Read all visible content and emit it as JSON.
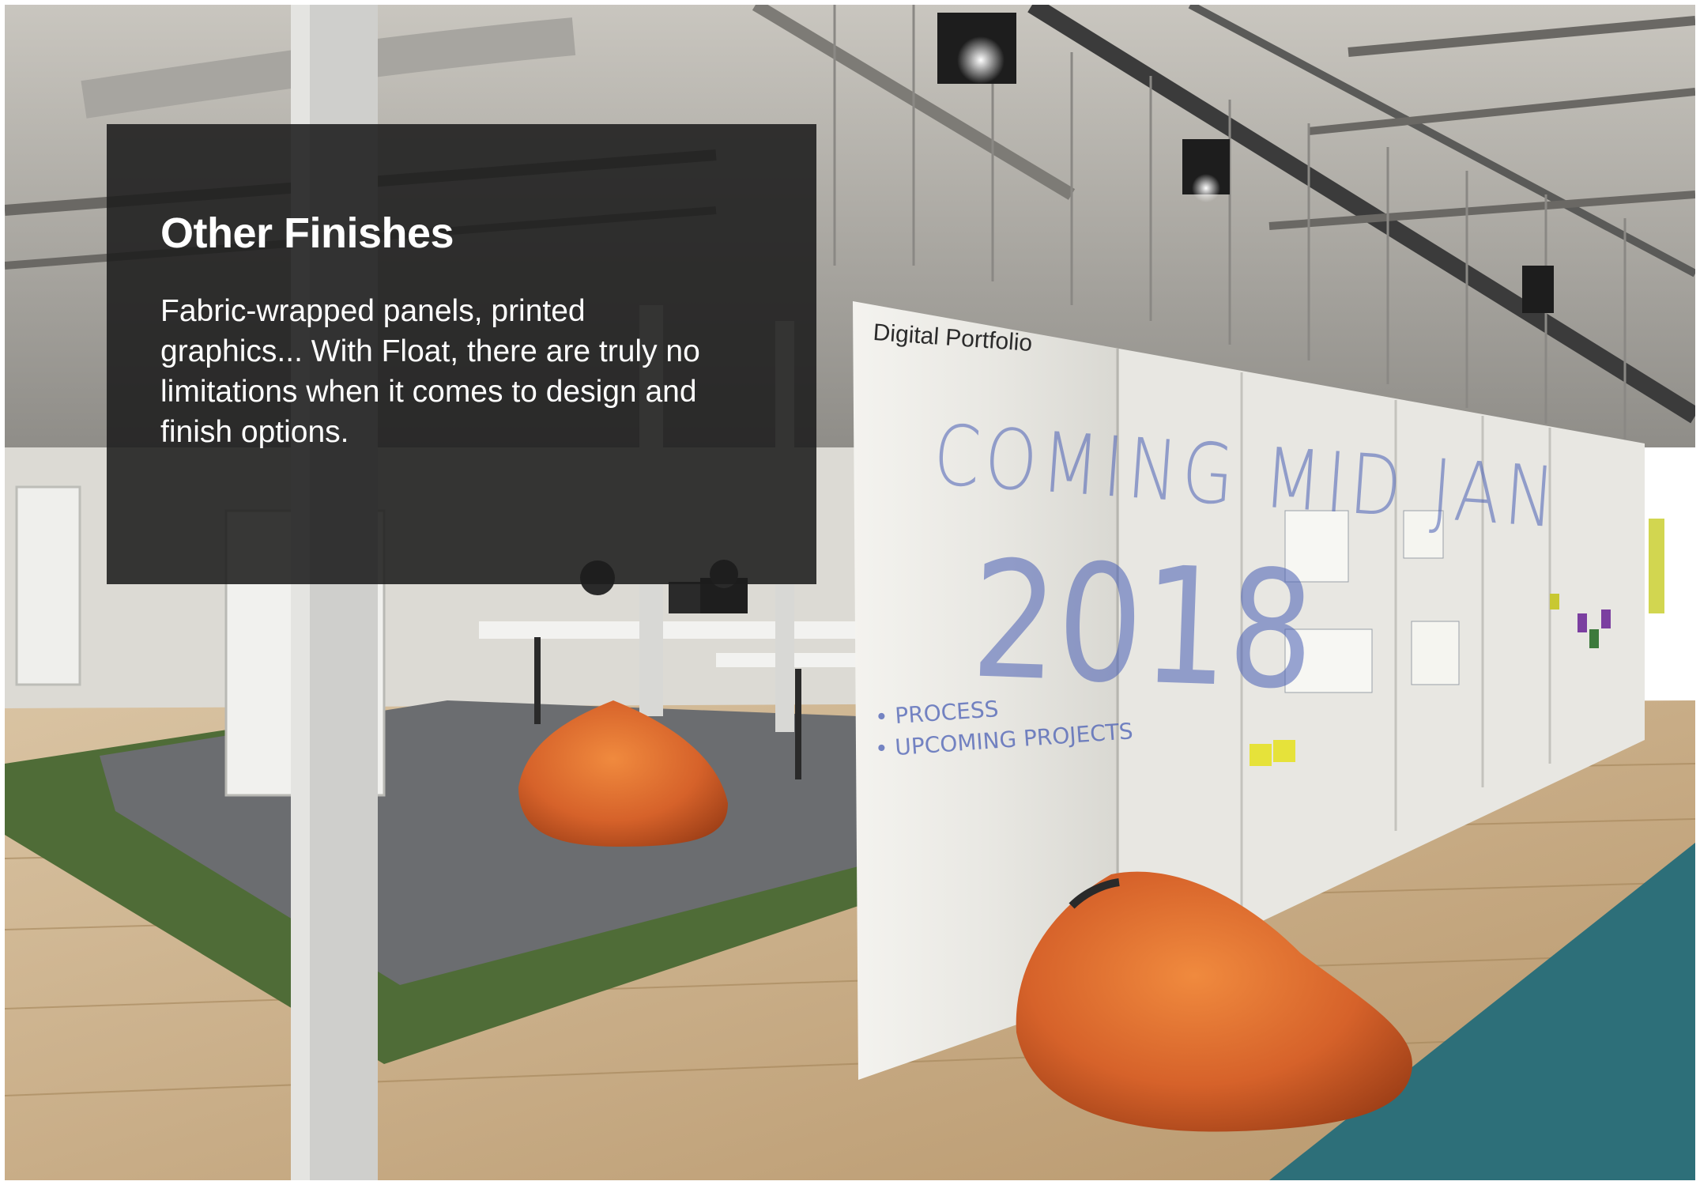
{
  "caption": {
    "title": "Other Finishes",
    "body": "Fabric-wrapped panels, printed graphics... With Float, there are truly no limitations when it comes to design and finish options."
  },
  "board": {
    "heading": "Digital Portfolio",
    "handwriting_line1": "COMING MID JAN",
    "handwriting_line2": "2018",
    "bullet_1": "• PROCESS",
    "bullet_2": "• UPCOMING PROJECTS"
  },
  "colors": {
    "caption_bg": "#1c1c1c",
    "caption_text": "#ffffff",
    "bean_bag": "#d8692b",
    "floor_wood": "#c9b08e",
    "carpet_green": "#4d6b35",
    "carpet_grey": "#6a6c6f",
    "carpet_teal": "#2b6e78"
  }
}
